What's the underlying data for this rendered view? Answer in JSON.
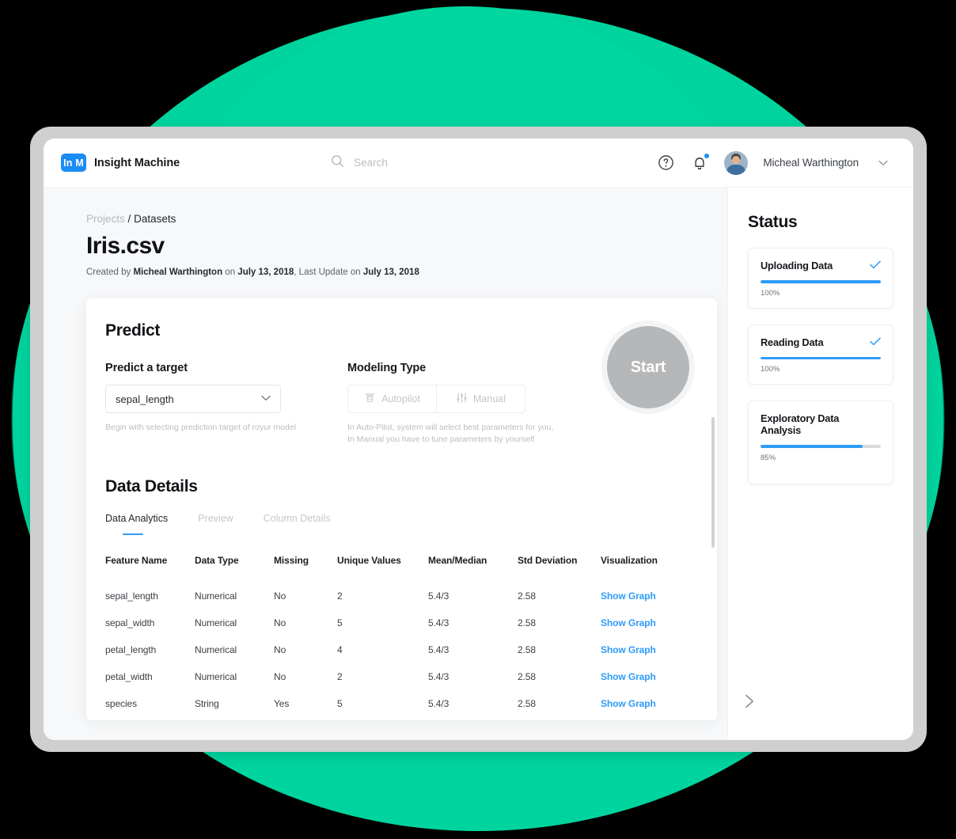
{
  "brand": {
    "logo_mark": "In M",
    "name": "Insight Machine",
    "logo_color": "#1b8cf5"
  },
  "search": {
    "placeholder": "Search",
    "value": ""
  },
  "user": {
    "name": "Micheal Warthington"
  },
  "breadcrumb": {
    "parent": "Projects",
    "separator": "/",
    "current": "Datasets"
  },
  "page": {
    "title": "Iris.csv",
    "meta_prefix": "Created by ",
    "meta_author": "Micheal Warthington",
    "meta_mid": " on ",
    "meta_created": "July 13, 2018",
    "meta_mid2": ", Last Update on ",
    "meta_updated": "July 13,  2018"
  },
  "predict": {
    "section_title": "Predict",
    "target_label": "Predict a target",
    "target_value": "sepal_length",
    "target_help": "Begin with selecting prediction target of royur model",
    "modeling_label": "Modeling Type",
    "mode_autopilot": "Autopilot",
    "mode_manual": "Manual",
    "modeling_help_line1": "In Auto-Pilot, system will select best parameters for you,",
    "modeling_help_line2": "In Manual you have to tune parameters by yourself",
    "start_label": "Start"
  },
  "data_details": {
    "section_title": "Data Details",
    "tabs": [
      {
        "label": "Data Analytics",
        "active": true
      },
      {
        "label": "Preview",
        "active": false
      },
      {
        "label": "Column Details",
        "active": false
      }
    ],
    "columns": [
      "Feature Name",
      "Data Type",
      "Missing",
      "Unique Values",
      "Mean/Median",
      "Std Deviation",
      "Visualization"
    ],
    "rows": [
      {
        "feature": "sepal_length",
        "type": "Numerical",
        "missing": "No",
        "unique": "2",
        "mean_median": "5.4/3",
        "std": "2.58",
        "action": "Show Graph"
      },
      {
        "feature": "sepal_width",
        "type": "Numerical",
        "missing": "No",
        "unique": "5",
        "mean_median": "5.4/3",
        "std": "2.58",
        "action": "Show Graph"
      },
      {
        "feature": "petal_length",
        "type": "Numerical",
        "missing": "No",
        "unique": "4",
        "mean_median": "5.4/3",
        "std": "2.58",
        "action": "Show Graph"
      },
      {
        "feature": "petal_width",
        "type": "Numerical",
        "missing": "No",
        "unique": "2",
        "mean_median": "5.4/3",
        "std": "2.58",
        "action": "Show Graph"
      },
      {
        "feature": "species",
        "type": "String",
        "missing": "Yes",
        "unique": "5",
        "mean_median": "5.4/3",
        "std": "2.58",
        "action": "Show Graph"
      }
    ]
  },
  "status": {
    "title": "Status",
    "accent": "#2e9bf7",
    "items": [
      {
        "name": "Uploading Data",
        "percent_label": "100%",
        "percent": 100,
        "complete": true
      },
      {
        "name": "Reading Data",
        "percent_label": "100%",
        "percent": 100,
        "complete": true
      },
      {
        "name": "Exploratory Data Analysis",
        "percent_label": "85%",
        "percent": 85,
        "complete": false
      }
    ]
  },
  "theme": {
    "green": "#00d49e",
    "blue": "#2e9bf7"
  }
}
